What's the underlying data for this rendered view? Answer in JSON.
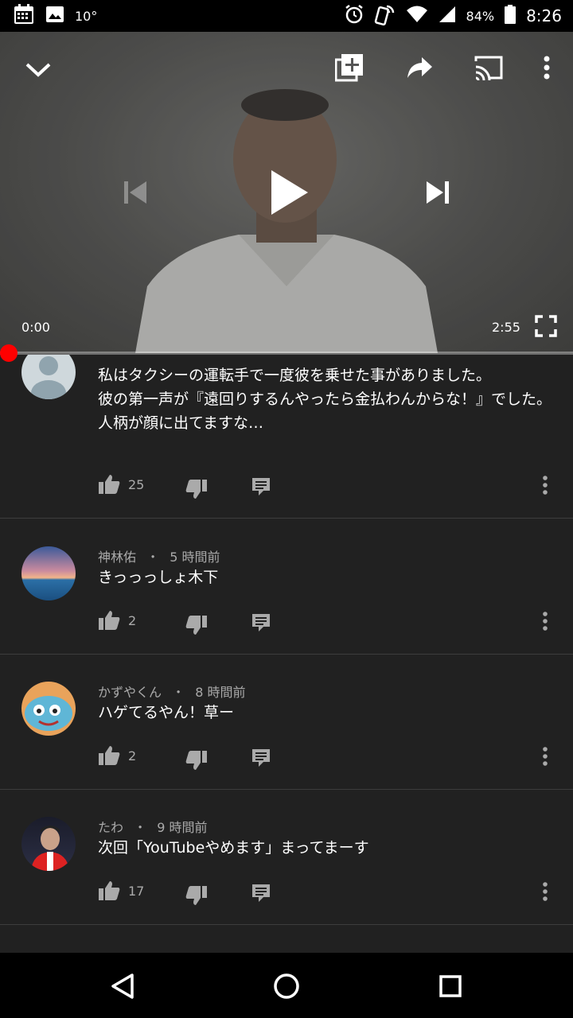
{
  "status_bar": {
    "temperature": "10°",
    "battery": "84%",
    "time": "8:26",
    "icons": [
      "calendar-icon",
      "image-icon",
      "alarm-icon",
      "nfc-icon",
      "wifi-icon",
      "signal-icon",
      "battery-icon"
    ]
  },
  "player": {
    "current_time": "0:00",
    "duration": "2:55",
    "progress": 0.0,
    "icons": [
      "collapse-chevron-icon",
      "add-to-playlist-icon",
      "share-icon",
      "cast-icon",
      "more-vert-icon",
      "previous-icon",
      "play-icon",
      "next-icon",
      "fullscreen-icon"
    ]
  },
  "comments": [
    {
      "author": "",
      "age": "",
      "text": "私はタクシーの運転手で一度彼を乗せた事がありました。\n彼の第一声が『遠回りするんやったら金払わんからな！』でした。\n人柄が顔に出てますな…",
      "likes": "25"
    },
    {
      "author": "神林佑",
      "age": "5 時間前",
      "text": "きっっっしょ木下",
      "likes": "2"
    },
    {
      "author": "かずやくん",
      "age": "8 時間前",
      "text": "ハゲてるやん！草ー",
      "likes": "2"
    },
    {
      "author": "たわ",
      "age": "9 時間前",
      "text": "次回「YouTubeやめます」まってまーす",
      "likes": "17"
    }
  ],
  "meta_separator": "・",
  "colors": {
    "background": "#212121",
    "accent_red": "#ff0000",
    "secondary_text": "#aaaaaa",
    "divider": "#3d3d3d"
  }
}
